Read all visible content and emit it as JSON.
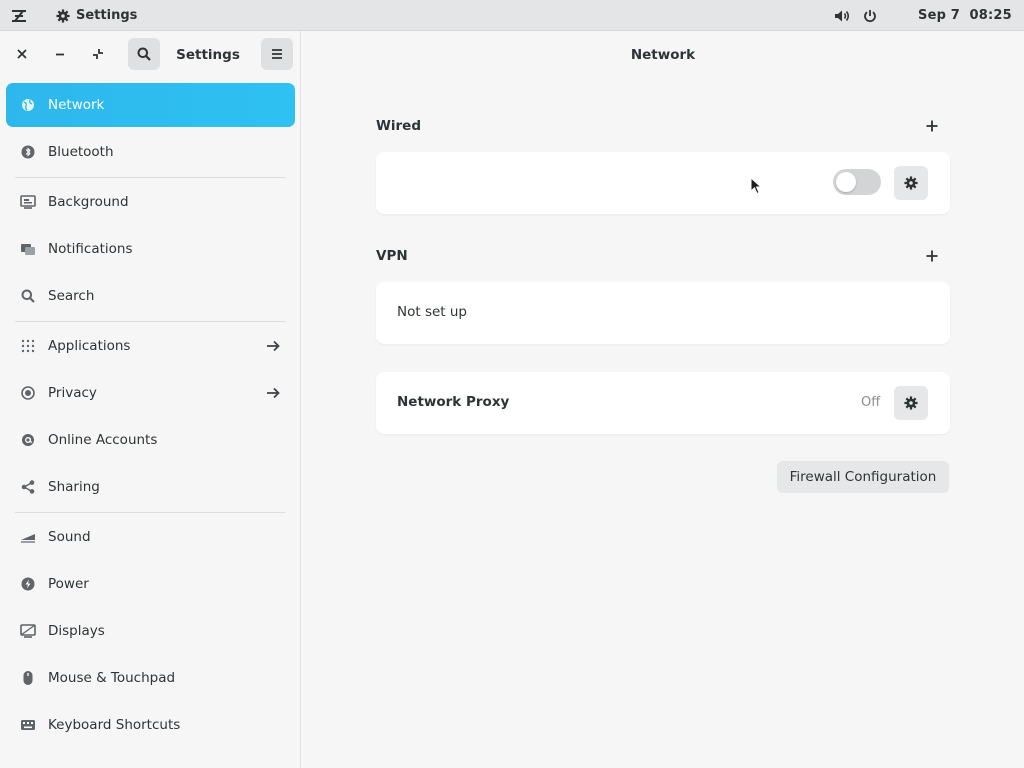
{
  "topbar": {
    "app_label": "Settings",
    "date": "Sep 7",
    "time": "08:25",
    "icons": [
      "activities-icon",
      "gear-icon",
      "volume-icon",
      "power-icon"
    ]
  },
  "sidebar": {
    "title": "Settings",
    "header_icons": [
      "close-icon",
      "minimize-icon",
      "restore-icon",
      "search-icon",
      "hamburger-menu-icon"
    ],
    "items": [
      {
        "label": "Network",
        "icon": "network-globe-icon",
        "active": true
      },
      {
        "label": "Bluetooth",
        "icon": "bluetooth-icon"
      },
      {
        "label": "Background",
        "icon": "monitor-icon"
      },
      {
        "label": "Notifications",
        "icon": "notification-icon"
      },
      {
        "label": "Search",
        "icon": "search-icon"
      },
      {
        "label": "Applications",
        "icon": "apps-grid-icon",
        "arrow": true
      },
      {
        "label": "Privacy",
        "icon": "privacy-icon",
        "arrow": true
      },
      {
        "label": "Online Accounts",
        "icon": "at-sign-icon"
      },
      {
        "label": "Sharing",
        "icon": "share-icon"
      },
      {
        "label": "Sound",
        "icon": "sound-icon"
      },
      {
        "label": "Power",
        "icon": "power-icon"
      },
      {
        "label": "Displays",
        "icon": "display-icon"
      },
      {
        "label": "Mouse & Touchpad",
        "icon": "mouse-icon"
      },
      {
        "label": "Keyboard Shortcuts",
        "icon": "keyboard-icon"
      }
    ]
  },
  "main": {
    "title": "Network",
    "wired": {
      "label": "Wired",
      "toggle_on": false
    },
    "vpn": {
      "label": "VPN",
      "status": "Not set up"
    },
    "proxy": {
      "label": "Network Proxy",
      "status": "Off"
    },
    "firewall_button": "Firewall Configuration"
  },
  "colors": {
    "accent": "#2eb7ec",
    "background": "#f6f6f7",
    "card": "#ffffff",
    "topbar": "#e4e5e7"
  }
}
